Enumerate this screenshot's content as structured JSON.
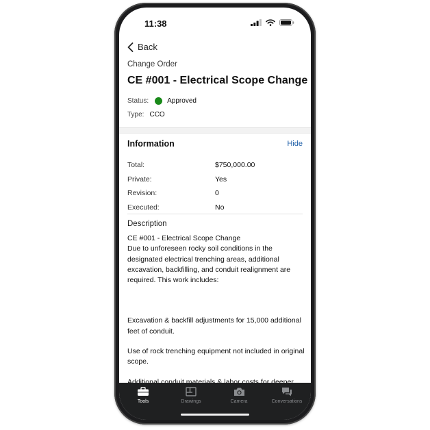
{
  "status_bar": {
    "time": "11:38"
  },
  "nav": {
    "back_label": "Back"
  },
  "header": {
    "breadcrumb": "Change Order",
    "title": "CE #001 - Electrical Scope Change",
    "status_label": "Status:",
    "status_value": "Approved",
    "status_color": "#1a8a1a",
    "type_label": "Type:",
    "type_value": "CCO"
  },
  "information": {
    "heading": "Information",
    "hide_label": "Hide",
    "rows": [
      {
        "label": "Total:",
        "value": "$750,000.00"
      },
      {
        "label": "Private:",
        "value": "Yes"
      },
      {
        "label": "Revision:",
        "value": "0"
      },
      {
        "label": "Executed:",
        "value": "No"
      }
    ]
  },
  "description": {
    "heading": "Description",
    "paragraphs": [
      "CE #001 - Electrical Scope Change",
      "Due to unforeseen rocky soil conditions in the designated electrical trenching areas, additional excavation, backfilling, and conduit realignment are required. This work includes:",
      "Excavation & backfill adjustments for 15,000 additional feet of conduit.",
      "Use of rock trenching equipment not included in original scope.",
      "Additional conduit materials & labor costs for deeper conduit placement"
    ]
  },
  "tabbar": {
    "accent": "#ffffff",
    "tabs": [
      {
        "label": "Tools",
        "icon": "toolbox-icon",
        "active": true
      },
      {
        "label": "Drawings",
        "icon": "drawings-icon",
        "active": false
      },
      {
        "label": "Camera",
        "icon": "camera-icon",
        "active": false
      },
      {
        "label": "Conversations",
        "icon": "chat-icon",
        "active": false
      }
    ]
  }
}
